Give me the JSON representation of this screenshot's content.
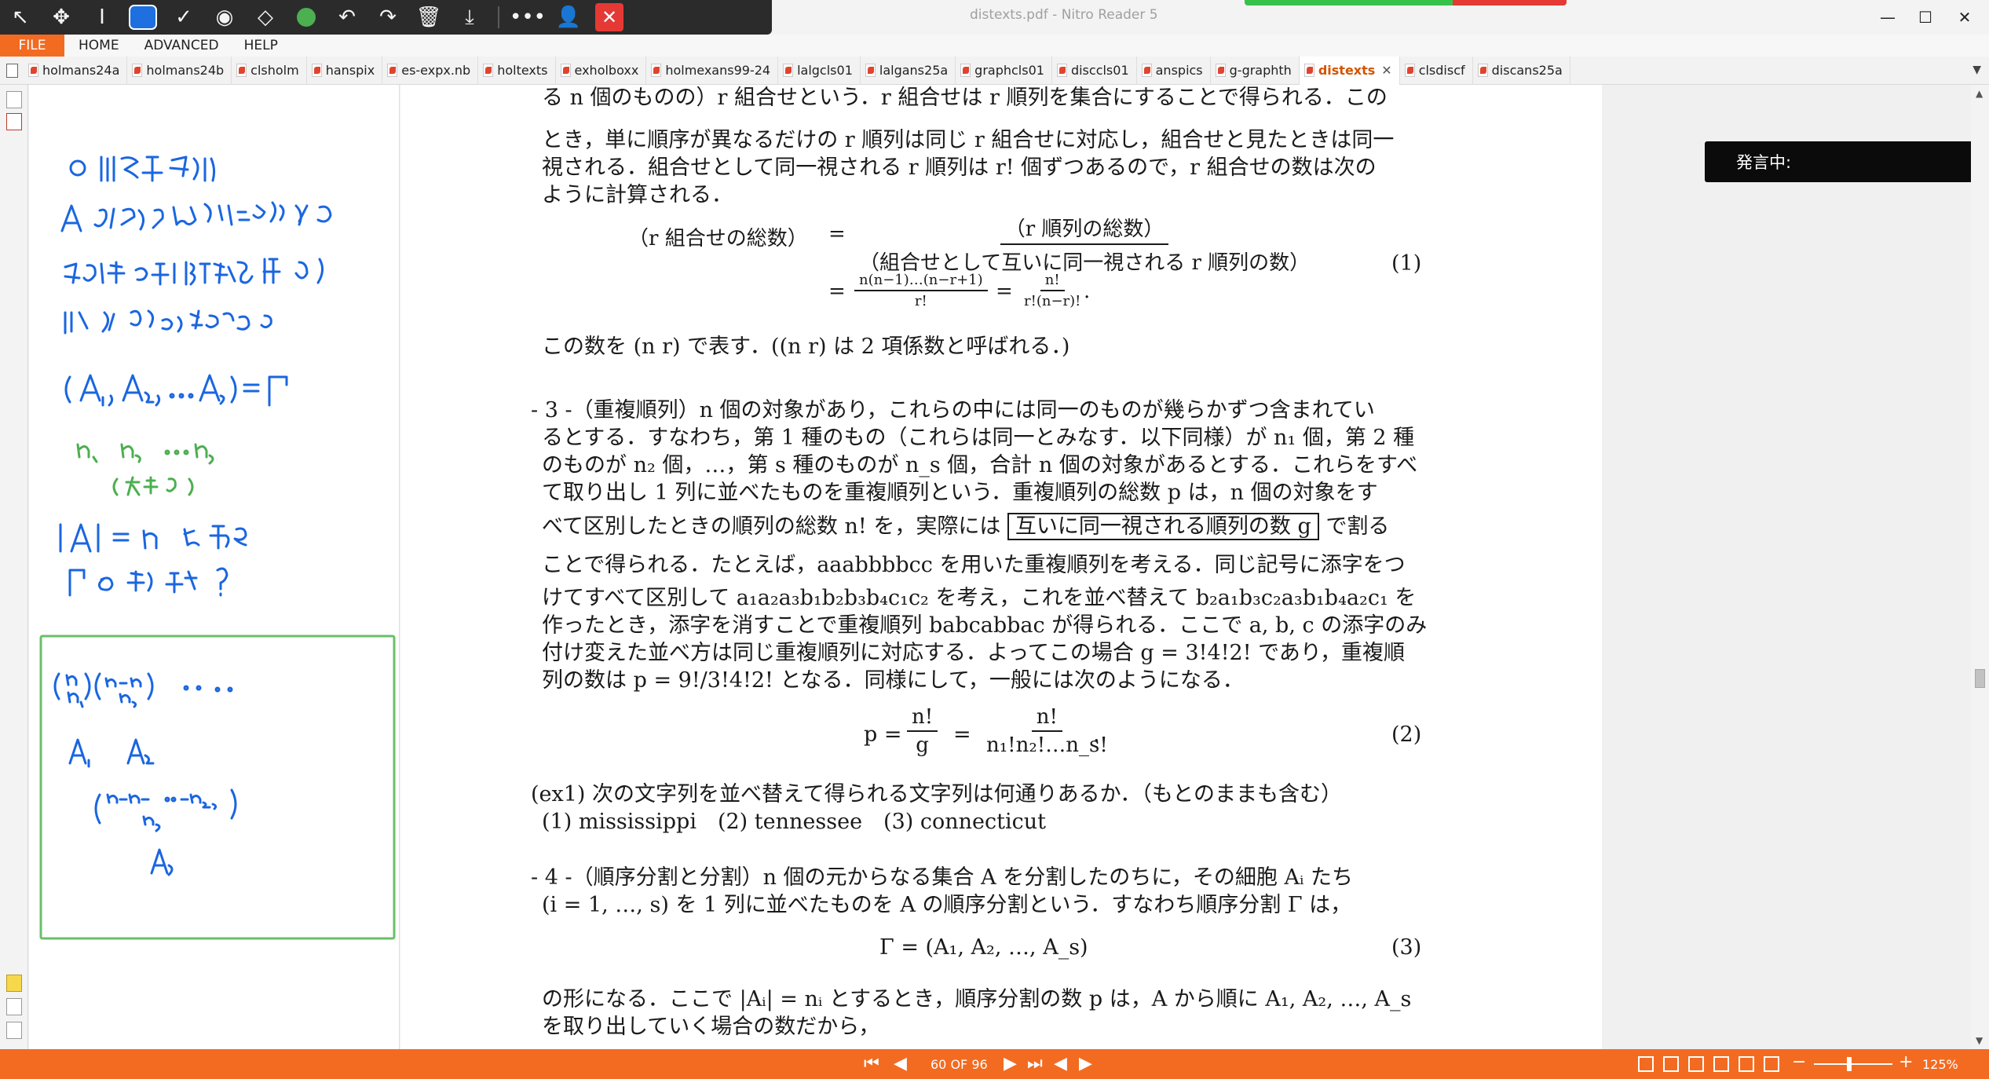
{
  "app": {
    "doc_title": "distexts.pdf - Nitro Reader 5",
    "window_controls": [
      "minimize",
      "maximize",
      "close"
    ]
  },
  "float_toolbar": {
    "tools": [
      "select-arrow-icon",
      "pan-move-icon",
      "text-cursor-icon",
      "rectangle-select-icon",
      "check-icon",
      "stamp-icon",
      "eraser-icon",
      "green-dot-icon",
      "undo-icon",
      "redo-icon",
      "delete-icon",
      "download-icon",
      "more-icon",
      "user-settings-icon",
      "close-icon"
    ],
    "active_tool": "rectangle-select-icon"
  },
  "menu": {
    "file": "FILE",
    "items": [
      "HOME",
      "ADVANCED",
      "HELP"
    ]
  },
  "tabs": [
    {
      "label": "holmans24a"
    },
    {
      "label": "holmans24b"
    },
    {
      "label": "clsholm"
    },
    {
      "label": "hanspix"
    },
    {
      "label": "es-expx.nb"
    },
    {
      "label": "holtexts"
    },
    {
      "label": "exholboxx"
    },
    {
      "label": "holmexans99-24"
    },
    {
      "label": "lalgcls01"
    },
    {
      "label": "lalgans25a"
    },
    {
      "label": "graphcls01"
    },
    {
      "label": "disccls01"
    },
    {
      "label": "anspics"
    },
    {
      "label": "g-graphth"
    },
    {
      "label": "distexts",
      "active": true
    },
    {
      "label": "clsdiscf"
    },
    {
      "label": "discans25a"
    }
  ],
  "notes": {
    "handwriting": "ⓐ 順序分割 / A に対して，それを 分割してその細胞を 1列に並べたもの / (A₁, A₂, …, A_s) = Γ / n₁ n₂ … n_s (大きさ) / |A| = n とする / Γ の総数？ / (n n₁)(n−n₁ n₂) … / A₁ A₂ / (n−n₁−…−n_{s−1} n_s) / A_s",
    "ink_blue": "#1a66e0",
    "ink_green": "#4caf50",
    "box_border": "#6abf69"
  },
  "document": {
    "lines": {
      "l1": "る n 個のものの）r 組合せという．r 組合せは r 順列を集合にすることで得られる．この",
      "l2": "とき，単に順序が異なるだけの r 順列は同じ r 組合せに対応し，組合せと見たときは同一",
      "l3": "視される．組合せとして同一視される r 順列は r! 個ずつあるので，r 組合せの数は次の",
      "l4": "ように計算される．",
      "binom_note": "この数を (n r) で表す．((n r) は 2 項係数と呼ばれる．)",
      "s3_1": "- 3 -（重複順列）n 個の対象があり，これらの中には同一のものが幾らかずつ含まれてい",
      "s3_2": "るとする．すなわち，第 1 種のもの（これらは同一とみなす．以下同様）が n₁ 個，第 2 種",
      "s3_3": "のものが n₂ 個，…，第 s 種のものが n_s 個，合計 n 個の対象があるとする．これらをすべ",
      "s3_4": "て取り出し 1 列に並べたものを重複順列という．重複順列の総数 p は，n 個の対象をす",
      "s3_5a": "べて区別したときの順列の総数 n! を，実際には",
      "s3_5box": "互いに同一視される順列の数 g",
      "s3_5b": "で割る",
      "s3_6": "ことで得られる．たとえば，aaabbbbcc を用いた重複順列を考える．同じ記号に添字をつ",
      "s3_7": "けてすべて区別して a₁a₂a₃b₁b₂b₃b₄c₁c₂ を考え，これを並べ替えて b₂a₁b₃c₂a₃b₁b₄a₂c₁ を",
      "s3_8": "作ったとき，添字を消すことで重複順列 babcabbac が得られる．ここで a, b, c の添字のみ",
      "s3_9": "付け変えた並べ方は同じ重複順列に対応する．よってこの場合 g = 3!4!2! であり，重複順",
      "s3_10": "列の数は p = 9!/3!4!2! となる．同様にして，一般には次のようになる．",
      "ex1_1": "(ex1) 次の文字列を並べ替えて得られる文字列は何通りあるか．（もとのままも含む）",
      "ex1_2": "(1) mississippi　(2) tennessee　(3) connecticut",
      "s4_1": "- 4 -（順序分割と分割）n 個の元からなる集合 A を分割したのちに，その細胞 Aᵢ たち",
      "s4_2": "(i = 1, …, s) を 1 列に並べたものを A の順序分割という．すなわち順序分割 Γ は，",
      "s4_3": "の形になる．ここで |Aᵢ| = nᵢ とするとき，順序分割の数 p は，A から順に A₁, A₂, …, A_s",
      "s4_4": "を取り出していく場合の数だから，"
    },
    "eq1": {
      "lhs": "（r 組合せの総数）",
      "eq": "=",
      "num": "（r 順列の総数）",
      "den": "（組合せとして互いに同一視される r 順列の数）",
      "eq2": "=",
      "num2": "n(n−1)…(n−r+1)",
      "den2": "r!",
      "eq3": "=",
      "num3": "n!",
      "den3": "r!(n−r)!",
      "end": ".",
      "number": "(1)"
    },
    "eq2": {
      "lhs": "p =",
      "num1": "n!",
      "den1": "g",
      "eq": "=",
      "num2": "n!",
      "den2": "n₁!n₂!…n_s!",
      "end": ".",
      "number": "(2)"
    },
    "eq3": {
      "body": "Γ = (A₁, A₂, …, A_s)",
      "number": "(3)"
    }
  },
  "overlay": {
    "speaking": "発言中:"
  },
  "status": {
    "page_indicator": "60 OF 96",
    "zoom": "125%",
    "nav_first": "⏮",
    "nav_prev": "◀",
    "nav_next": "▶",
    "nav_last": "⏭",
    "zoom_minus": "−",
    "zoom_plus": "+"
  },
  "colors": {
    "accent_orange": "#f36b21",
    "toolbar_dark": "#2b2b2b",
    "selected_blue": "#1e6fe0"
  }
}
